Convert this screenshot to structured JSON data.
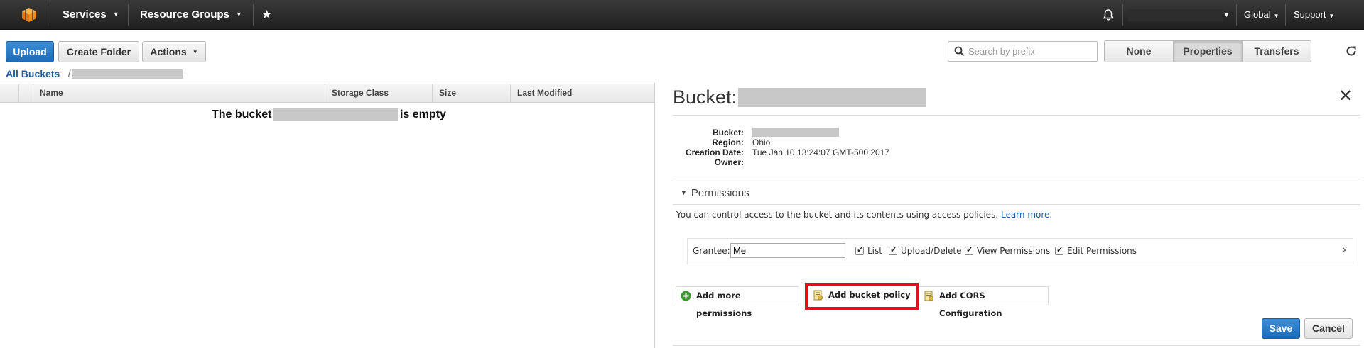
{
  "nav": {
    "services": "Services",
    "resource_groups": "Resource Groups",
    "region": "Global",
    "support": "Support"
  },
  "toolbar": {
    "upload": "Upload",
    "create_folder": "Create Folder",
    "actions": "Actions",
    "search_placeholder": "Search by prefix",
    "view_none": "None",
    "view_properties": "Properties",
    "view_transfers": "Transfers"
  },
  "breadcrumb": {
    "root": "All Buckets",
    "separator": "/"
  },
  "table": {
    "columns": [
      "Name",
      "Storage Class",
      "Size",
      "Last Modified"
    ],
    "empty_prefix": "The bucket",
    "empty_suffix": "is empty"
  },
  "panel": {
    "title": "Bucket:",
    "close": "✕",
    "properties": [
      {
        "label": "Bucket:",
        "value": ""
      },
      {
        "label": "Region:",
        "value": "Ohio"
      },
      {
        "label": "Creation Date:",
        "value": "Tue Jan 10 13:24:07 GMT-500 2017"
      },
      {
        "label": "Owner:",
        "value": ""
      }
    ],
    "permissions": {
      "title": "Permissions",
      "description": "You can control access to the bucket and its contents using access policies.",
      "learn_more": "Learn more",
      "grantee_label": "Grantee:",
      "grantee_value": "Me",
      "checkboxes": [
        "List",
        "Upload/Delete",
        "View Permissions",
        "Edit Permissions"
      ],
      "remove": "x"
    },
    "actions": {
      "add_permissions": "Add more permissions",
      "add_bucket_policy": "Add bucket policy",
      "add_cors": "Add CORS Configuration"
    },
    "save": "Save",
    "cancel": "Cancel"
  },
  "icons": {
    "logo": "aws-cube-icon",
    "bell": "bell-icon",
    "pin": "pin-icon",
    "search": "search-icon",
    "refresh": "refresh-icon"
  },
  "colors": {
    "accent": "#1e6bb8",
    "highlight": "#d8141c",
    "link": "#1f5ea8",
    "logo": "#f29111"
  }
}
